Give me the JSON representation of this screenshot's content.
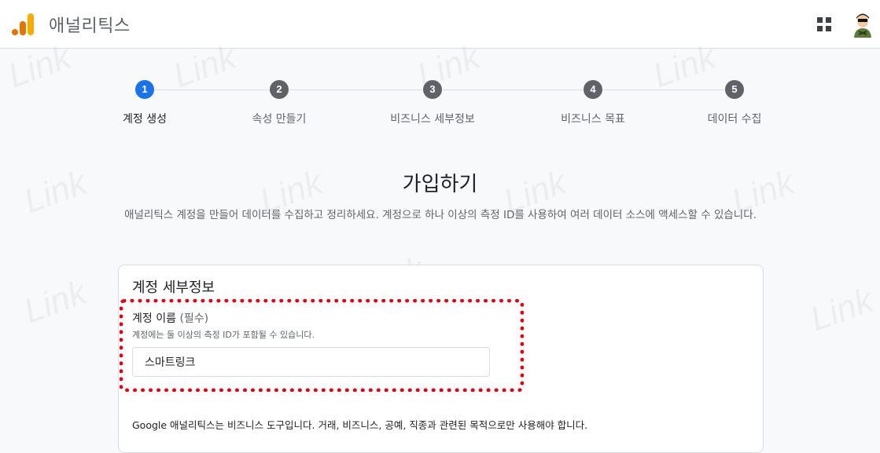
{
  "header": {
    "title": "애널리틱스",
    "brand_color": "#f9ab00",
    "apps_icon": "grid-icon",
    "avatar_icon": "user-avatar"
  },
  "stepper": {
    "steps": [
      {
        "number": "1",
        "label": "계정 생성",
        "active": true
      },
      {
        "number": "2",
        "label": "속성 만들기",
        "active": false
      },
      {
        "number": "3",
        "label": "비즈니스 세부정보",
        "active": false
      },
      {
        "number": "4",
        "label": "비즈니스 목표",
        "active": false
      },
      {
        "number": "5",
        "label": "데이터 수집",
        "active": false
      }
    ],
    "active_color": "#1a73e8",
    "inactive_color": "#5f6368"
  },
  "main": {
    "title": "가입하기",
    "description": "애널리틱스 계정을 만들어 데이터를 수집하고 정리하세요. 계정으로 하나 이상의 측정 ID를 사용하여 여러 데이터 소스에 액세스할 수 있습니다."
  },
  "card": {
    "title": "계정 세부정보",
    "field_label": "계정 이름",
    "field_required": "(필수)",
    "field_hint": "계정에는 둘 이상의 측정 ID가 포함될 수 있습니다.",
    "field_value": "스마트링크",
    "footer_note": "Google 애널리틱스는 비즈니스 도구입니다. 거래, 비즈니스, 공예, 직종과 관련된 목적으로만 사용해야 합니다.",
    "highlight_color": "#e60012"
  },
  "watermark": "Link"
}
